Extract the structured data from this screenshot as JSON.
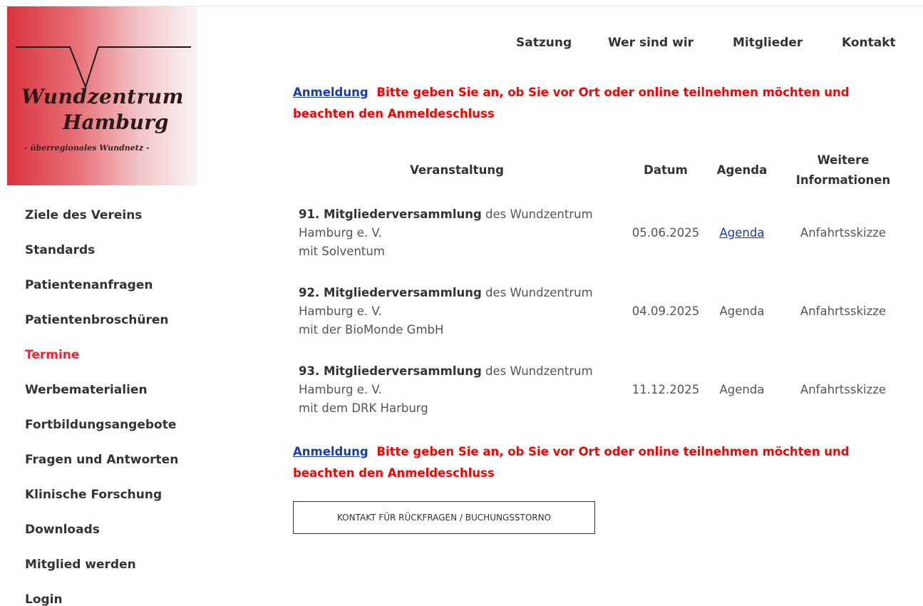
{
  "logo": {
    "line1": "Wundzentrum",
    "line2": "Hamburg",
    "tagline": "- überregionales Wundnetz -"
  },
  "top_nav": {
    "items": [
      {
        "label": "Satzung"
      },
      {
        "label": "Wer sind wir"
      },
      {
        "label": "Mitglieder"
      },
      {
        "label": "Kontakt"
      }
    ]
  },
  "sidebar": {
    "items": [
      {
        "label": "Ziele des Vereins"
      },
      {
        "label": "Standards"
      },
      {
        "label": "Patientenanfragen"
      },
      {
        "label": "Patientenbroschüren"
      },
      {
        "label": "Termine",
        "active": true
      },
      {
        "label": "Werbematerialien"
      },
      {
        "label": "Fortbildungsangebote"
      },
      {
        "label": "Fragen und Antworten"
      },
      {
        "label": "Klinische Forschung"
      },
      {
        "label": "Downloads"
      },
      {
        "label": "Mitglied werden"
      },
      {
        "label": "Login"
      }
    ]
  },
  "notice": {
    "link_label": "Anmeldung",
    "text": "Bitte geben Sie an, ob Sie vor Ort oder online teilnehmen möchten und beachten den Anmeldeschluss"
  },
  "table": {
    "headers": {
      "event": "Veranstaltung",
      "date": "Datum",
      "agenda": "Agenda",
      "info_line1": "Weitere",
      "info_line2": "Informationen"
    },
    "rows": [
      {
        "title": "91. Mitgliederversammlung",
        "rest": " des Wundzentrum",
        "line2": "Hamburg e. V.",
        "line3": "mit Solventum",
        "date": "05.06.2025",
        "agenda": "Agenda",
        "agenda_is_link": true,
        "info": "Anfahrtsskizze"
      },
      {
        "title": "92. Mitgliederversammlung",
        "rest": " des Wundzentrum",
        "line2": "Hamburg e. V.",
        "line3": "mit der BioMonde GmbH",
        "date": "04.09.2025",
        "agenda": "Agenda",
        "agenda_is_link": false,
        "info": "Anfahrtsskizze"
      },
      {
        "title": "93. Mitgliederversammlung",
        "rest": " des Wundzentrum",
        "line2": "Hamburg e. V.",
        "line3": "mit dem DRK Harburg",
        "date": "11.12.2025",
        "agenda": "Agenda",
        "agenda_is_link": false,
        "info": "Anfahrtsskizze"
      }
    ]
  },
  "contact_button": {
    "label": "KONTAKT FÜR RÜCKFRAGEN / BUCHUNGSSTORNO"
  },
  "colors": {
    "accent_red": "#ff0000",
    "active_nav": "#ff1a2e",
    "link_blue": "#1a3ea8",
    "text_dark": "#333333",
    "text_body": "#555555"
  }
}
